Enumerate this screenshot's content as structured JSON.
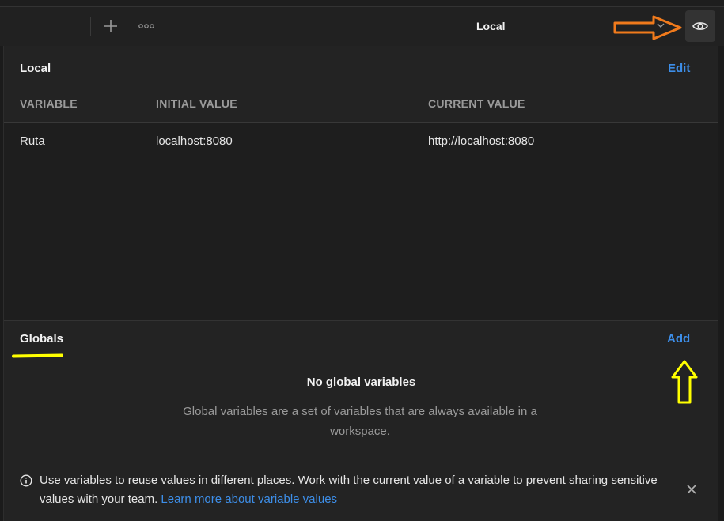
{
  "environment": {
    "selected": "Local"
  },
  "local": {
    "title": "Local",
    "edit_label": "Edit",
    "columns": [
      "VARIABLE",
      "INITIAL VALUE",
      "CURRENT VALUE"
    ],
    "rows": [
      {
        "variable": "Ruta",
        "initial": "localhost:8080",
        "current": "http://localhost:8080"
      }
    ]
  },
  "globals": {
    "title": "Globals",
    "add_label": "Add",
    "empty_title": "No global variables",
    "empty_description": "Global variables are a set of variables that are always available in a workspace."
  },
  "info_banner": {
    "text": "Use variables to reuse values in different places. Work with the current value of a variable to prevent sharing sensitive values with your team.",
    "link_text": "Learn more about variable values"
  },
  "colors": {
    "accent": "#3d8ee8",
    "annotation_orange": "#f07a1c",
    "annotation_yellow": "#ffff00"
  }
}
